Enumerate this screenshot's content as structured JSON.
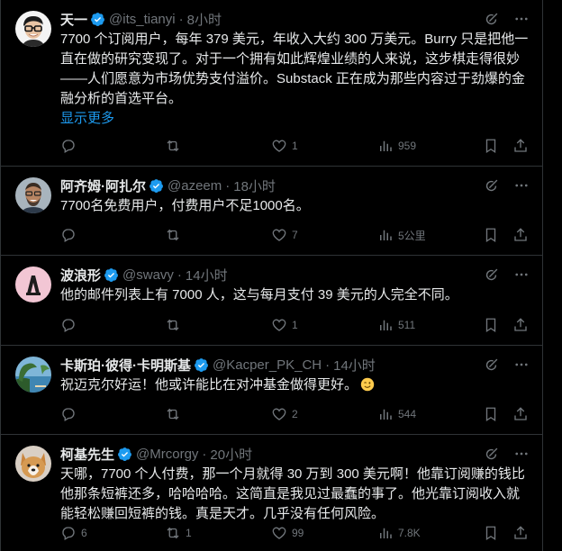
{
  "tweets": [
    {
      "name": "天一",
      "handle": "@its_tianyi",
      "time": "8小时",
      "text": "7700 个订阅用户，每年 379 美元，年收入大约 300 万美元。Burry 只是把他一直在做的研究变现了。对于一个拥有如此辉煌业绩的人来说，这步棋走得很妙——人们愿意为市场优势支付溢价。Substack 正在成为那些内容过于劲爆的金融分析的首选平台。",
      "show_more": "显示更多",
      "replies": "",
      "retweets": "",
      "likes": "1",
      "views": "959"
    },
    {
      "name": "阿齐姆·阿扎尔",
      "handle": "@azeem",
      "time": "18小时",
      "text": "7700名免费用户，付费用户不足1000名。",
      "replies": "",
      "retweets": "",
      "likes": "7",
      "views": "5公里"
    },
    {
      "name": "波浪形",
      "handle": "@swavy",
      "time": "14小时",
      "text": "他的邮件列表上有 7000 人，这与每月支付 39 美元的人完全不同。",
      "replies": "",
      "retweets": "",
      "likes": "1",
      "views": "511"
    },
    {
      "name": "卡斯珀·彼得·卡明斯基",
      "handle": "@Kacper_PK_CH",
      "time": "14小时",
      "text": "祝迈克尔好运！他或许能比在对冲基金做得更好。",
      "replies": "",
      "retweets": "",
      "likes": "2",
      "views": "544"
    },
    {
      "name": "柯基先生",
      "handle": "@Mrcorgy",
      "time": "20小时",
      "text": "天哪，7700 个人付费，那一个月就得 30 万到 300 美元啊！他靠订阅赚的钱比他那条短裤还多，哈哈哈哈。这简直是我见过最蠢的事了。他光靠订阅收入就能轻松赚回短裤的钱。真是天才。几乎没有任何风险。",
      "replies": "6",
      "retweets": "1",
      "likes": "99",
      "views": "7.8K"
    }
  ],
  "colors": {
    "background": "#000000",
    "text": "#e7e9ea",
    "muted": "#71767b",
    "link": "#1d9bf0",
    "border": "#2f3336"
  }
}
